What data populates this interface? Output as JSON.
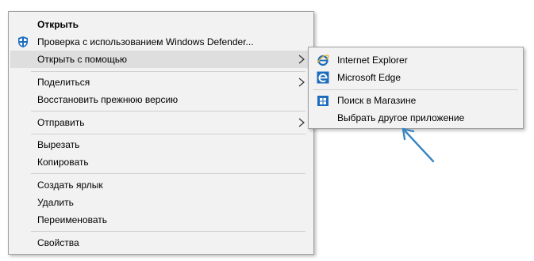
{
  "context_menu": {
    "items": {
      "open": "Открыть",
      "defender_scan": "Проверка с использованием Windows Defender...",
      "open_with": "Открыть с помощью",
      "share": "Поделиться",
      "restore_previous": "Восстановить прежнюю версию",
      "send_to": "Отправить",
      "cut": "Вырезать",
      "copy": "Копировать",
      "create_shortcut": "Создать ярлык",
      "delete": "Удалить",
      "rename": "Переименовать",
      "properties": "Свойства"
    }
  },
  "open_with_submenu": {
    "internet_explorer": "Internet Explorer",
    "microsoft_edge": "Microsoft Edge",
    "search_store": "Поиск в Магазине",
    "choose_other_app": "Выбрать другое приложение"
  },
  "colors": {
    "menu_bg": "#f2f2f2",
    "hover_bg": "#dedede",
    "accent": "#1c6cbf",
    "annotation_arrow": "#3a86c0"
  },
  "icons": {
    "defender": "shield-icon",
    "internet_explorer": "internet-explorer-icon",
    "edge": "edge-icon",
    "store": "store-icon",
    "submenu": "chevron-right-icon",
    "annotation": "pointer-arrow-icon"
  }
}
